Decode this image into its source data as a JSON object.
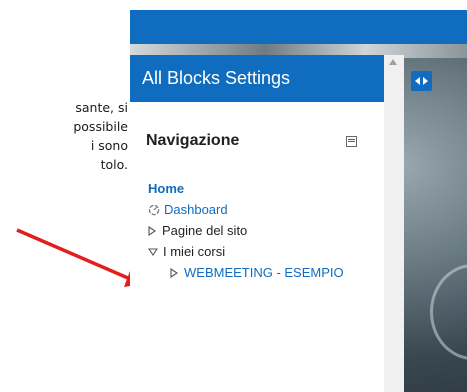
{
  "left_text": {
    "lines": [
      "sante, si",
      "possibile",
      "i sono",
      "tolo."
    ]
  },
  "drawer": {
    "title": "All Blocks Settings"
  },
  "block": {
    "title": "Navigazione"
  },
  "nav": {
    "home": "Home",
    "dashboard": "Dashboard",
    "site_pages": "Pagine del sito",
    "my_courses": "I miei corsi",
    "course": "WEBMEETING - ESEMPIO"
  },
  "colors": {
    "accent": "#0f6cbf",
    "arrow": "#e31e1e"
  },
  "icons": {
    "toggle": "arrows-left-right-icon",
    "collapse": "collapse-block-icon",
    "dashboard": "dashboard-icon"
  }
}
